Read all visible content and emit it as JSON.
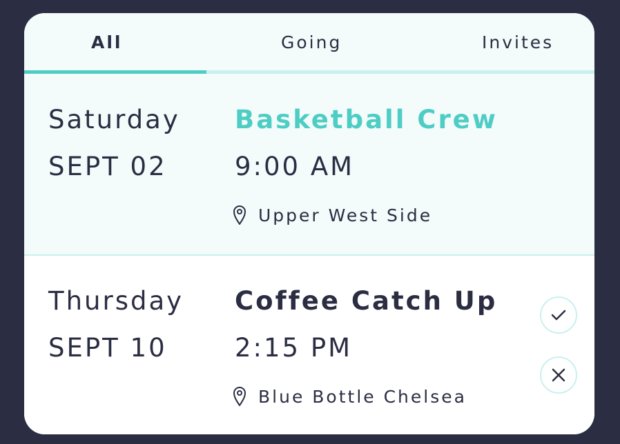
{
  "tabs": [
    {
      "label": "All",
      "active": true
    },
    {
      "label": "Going",
      "active": false
    },
    {
      "label": "Invites",
      "active": false
    }
  ],
  "events": [
    {
      "day": "Saturday",
      "date": "SEPT 02",
      "title": "Basketball Crew",
      "time": "9:00 AM",
      "location": "Upper West Side",
      "location_icon": "map-pin-icon"
    },
    {
      "day": "Thursday",
      "date": "SEPT 10",
      "title": "Coffee Catch Up",
      "time": "2:15 PM",
      "location": "Blue Bottle Chelsea",
      "location_icon": "map-pin-icon",
      "accept_icon": "check-icon",
      "decline_icon": "close-icon"
    }
  ],
  "colors": {
    "background": "#2b2d42",
    "accent": "#4ecdc4",
    "text": "#2b2d42",
    "highlight_bg": "#f3fbfb",
    "divider": "#c9f0ef"
  }
}
